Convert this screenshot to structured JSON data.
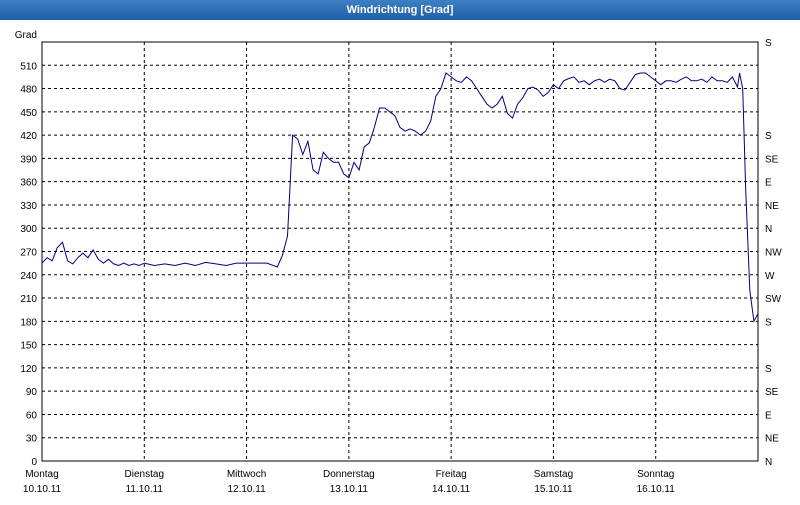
{
  "window": {
    "title": "Windrichtung [Grad]"
  },
  "chart_data": {
    "type": "line",
    "title": "Windrichtung [Grad]",
    "ylabel": "Grad",
    "ylim": [
      0,
      540
    ],
    "grid": true,
    "y_ticks": [
      0,
      30,
      60,
      90,
      120,
      150,
      180,
      210,
      240,
      270,
      300,
      330,
      360,
      390,
      420,
      450,
      480,
      510
    ],
    "right_axis_labels": [
      {
        "value": 0,
        "label": "N"
      },
      {
        "value": 30,
        "label": "NE"
      },
      {
        "value": 60,
        "label": "E"
      },
      {
        "value": 90,
        "label": "SE"
      },
      {
        "value": 120,
        "label": "S"
      },
      {
        "value": 180,
        "label": "S"
      },
      {
        "value": 210,
        "label": "SW"
      },
      {
        "value": 240,
        "label": "W"
      },
      {
        "value": 270,
        "label": "NW"
      },
      {
        "value": 300,
        "label": "N"
      },
      {
        "value": 330,
        "label": "NE"
      },
      {
        "value": 360,
        "label": "E"
      },
      {
        "value": 390,
        "label": "SE"
      },
      {
        "value": 420,
        "label": "S"
      }
    ],
    "xlim": [
      0,
      7
    ],
    "x_ticks": [
      {
        "value": 0,
        "day": "Montag",
        "date": "10.10.11"
      },
      {
        "value": 1,
        "day": "Dienstag",
        "date": "11.10.11"
      },
      {
        "value": 2,
        "day": "Mittwoch",
        "date": "12.10.11"
      },
      {
        "value": 3,
        "day": "Donnerstag",
        "date": "13.10.11"
      },
      {
        "value": 4,
        "day": "Freitag",
        "date": "14.10.11"
      },
      {
        "value": 5,
        "day": "Samstag",
        "date": "15.10.11"
      },
      {
        "value": 6,
        "day": "Sonntag",
        "date": "16.10.11"
      }
    ],
    "series": [
      {
        "color": "#000080",
        "x": [
          0.0,
          0.05,
          0.1,
          0.15,
          0.2,
          0.25,
          0.3,
          0.35,
          0.4,
          0.45,
          0.5,
          0.55,
          0.6,
          0.65,
          0.7,
          0.75,
          0.8,
          0.85,
          0.9,
          0.95,
          1.0,
          1.1,
          1.2,
          1.3,
          1.4,
          1.5,
          1.6,
          1.7,
          1.8,
          1.9,
          2.0,
          2.1,
          2.2,
          2.3,
          2.35,
          2.4,
          2.45,
          2.5,
          2.55,
          2.6,
          2.65,
          2.7,
          2.75,
          2.8,
          2.85,
          2.9,
          2.95,
          3.0,
          3.05,
          3.1,
          3.15,
          3.2,
          3.25,
          3.3,
          3.35,
          3.4,
          3.45,
          3.5,
          3.55,
          3.6,
          3.65,
          3.7,
          3.75,
          3.8,
          3.85,
          3.9,
          3.95,
          4.0,
          4.05,
          4.1,
          4.15,
          4.2,
          4.25,
          4.3,
          4.35,
          4.4,
          4.45,
          4.5,
          4.55,
          4.6,
          4.65,
          4.7,
          4.75,
          4.8,
          4.85,
          4.9,
          4.95,
          5.0,
          5.05,
          5.1,
          5.15,
          5.2,
          5.25,
          5.3,
          5.35,
          5.4,
          5.45,
          5.5,
          5.55,
          5.6,
          5.65,
          5.7,
          5.75,
          5.8,
          5.85,
          5.9,
          5.95,
          6.0,
          6.05,
          6.1,
          6.15,
          6.2,
          6.25,
          6.3,
          6.35,
          6.4,
          6.45,
          6.5,
          6.55,
          6.6,
          6.65,
          6.7,
          6.75,
          6.8,
          6.82,
          6.85,
          6.88,
          6.92,
          6.96,
          7.0
        ],
        "values": [
          255,
          262,
          258,
          275,
          282,
          258,
          254,
          262,
          268,
          262,
          272,
          260,
          255,
          260,
          254,
          252,
          255,
          252,
          254,
          252,
          255,
          252,
          254,
          252,
          255,
          252,
          256,
          254,
          252,
          255,
          255,
          255,
          255,
          250,
          265,
          290,
          420,
          415,
          395,
          412,
          375,
          370,
          398,
          390,
          385,
          385,
          370,
          365,
          385,
          375,
          405,
          410,
          430,
          455,
          455,
          450,
          445,
          430,
          425,
          428,
          425,
          420,
          425,
          438,
          470,
          480,
          500,
          495,
          490,
          488,
          495,
          490,
          480,
          470,
          460,
          455,
          460,
          470,
          448,
          442,
          460,
          468,
          480,
          482,
          478,
          470,
          475,
          485,
          480,
          490,
          493,
          495,
          488,
          490,
          485,
          490,
          492,
          488,
          492,
          490,
          480,
          478,
          488,
          498,
          500,
          500,
          495,
          490,
          485,
          490,
          490,
          488,
          492,
          495,
          490,
          490,
          492,
          488,
          495,
          490,
          490,
          488,
          495,
          482,
          500,
          480,
          350,
          220,
          180,
          190
        ]
      }
    ]
  }
}
